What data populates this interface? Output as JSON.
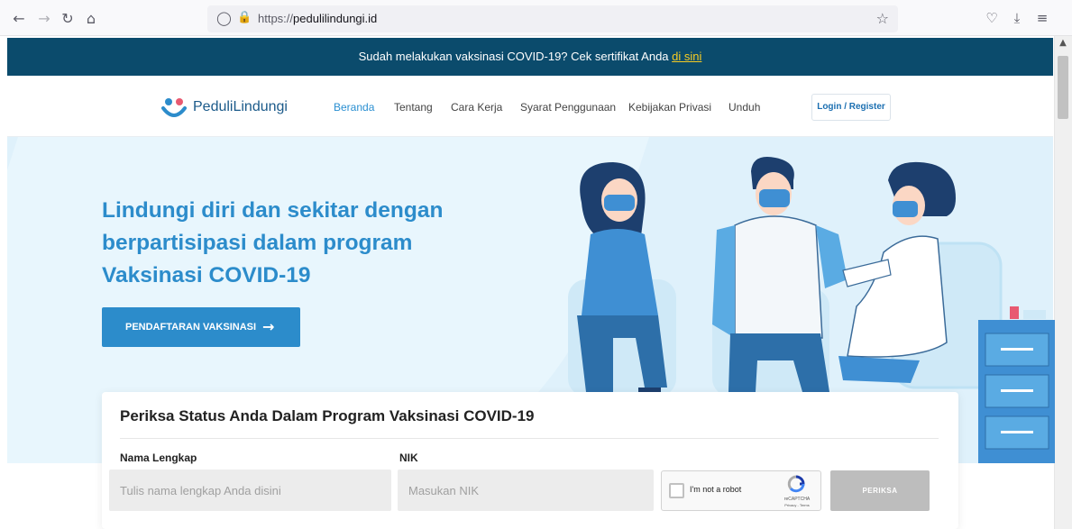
{
  "browser": {
    "back_icon": "arrow-left-icon",
    "forward_icon": "arrow-right-icon",
    "reload_icon": "reload-icon",
    "home_icon": "home-icon",
    "url_prefix": "https://",
    "url_host": "pedulilindungi.id",
    "bookmark_icon": "star-icon",
    "pocket_icon": "pocket-icon",
    "download_icon": "download-icon",
    "menu_icon": "hamburger-menu-icon"
  },
  "announcement": {
    "text": "Sudah melakukan vaksinasi COVID-19? Cek sertifikat Anda",
    "link": "di sini"
  },
  "header": {
    "logo_text": "PeduliLindungi",
    "nav": [
      {
        "label": "Beranda",
        "active": true
      },
      {
        "label": "Tentang",
        "active": false
      },
      {
        "label": "Cara Kerja",
        "active": false
      },
      {
        "label": "Syarat Penggunaan",
        "active": false
      },
      {
        "label": "Kebijakan Privasi",
        "active": false
      },
      {
        "label": "Unduh",
        "active": false
      }
    ],
    "login_label": "Login / Register"
  },
  "hero": {
    "title_lines": [
      "Lindungi diri dan sekitar dengan",
      "berpartisipasi dalam program",
      "Vaksinasi COVID-19"
    ],
    "cta_label": "PENDAFTARAN VAKSINASI"
  },
  "status_form": {
    "title": "Periksa Status Anda Dalam Program Vaksinasi COVID-19",
    "name_label": "Nama Lengkap",
    "name_placeholder": "Tulis nama lengkap Anda disini",
    "nik_label": "NIK",
    "nik_placeholder": "Masukan NIK",
    "recaptcha_label": "I'm not a robot",
    "recaptcha_brand": "reCAPTCHA",
    "recaptcha_terms": "Privacy - Terms",
    "submit_label": "PERIKSA"
  },
  "colors": {
    "announcement_bg": "#0b4b6c",
    "link_yellow": "#f7cc23",
    "brand_blue": "#2c8ccb",
    "hero_bg": "#dff1fb"
  }
}
